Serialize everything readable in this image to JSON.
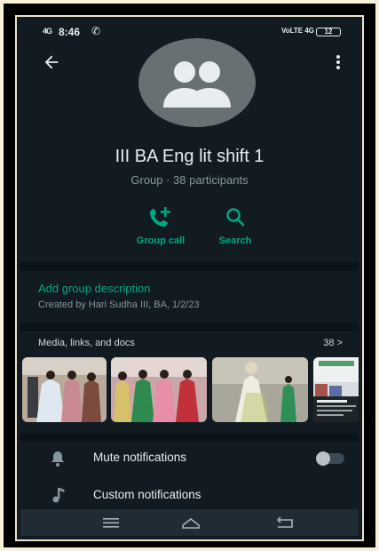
{
  "status_bar": {
    "signal": "4G",
    "time": "8:46",
    "network": "VoLTE 4G",
    "battery": "12"
  },
  "header": {
    "group_name": "III BA Eng lit shift 1",
    "group_subtitle": "Group · 38 participants"
  },
  "actions": [
    {
      "label": "Group call",
      "icon": "add-call-icon"
    },
    {
      "label": "Search",
      "icon": "search-icon"
    }
  ],
  "description": {
    "add_label": "Add group description",
    "created_text": "Created by Hari Sudha III, BA, 1/2/23"
  },
  "media": {
    "title": "Media, links, and docs",
    "count": "38 >"
  },
  "settings": [
    {
      "label": "Mute notifications",
      "icon": "bell-icon",
      "toggle_on": false
    },
    {
      "label": "Custom notifications",
      "icon": "music-note-icon"
    }
  ],
  "nav_bar": [
    "menu-icon",
    "home-icon",
    "back-icon"
  ],
  "colors": {
    "background": "#111b21",
    "accent": "#00a884",
    "primary_text": "#e9edef",
    "secondary_text": "#8696a0"
  }
}
